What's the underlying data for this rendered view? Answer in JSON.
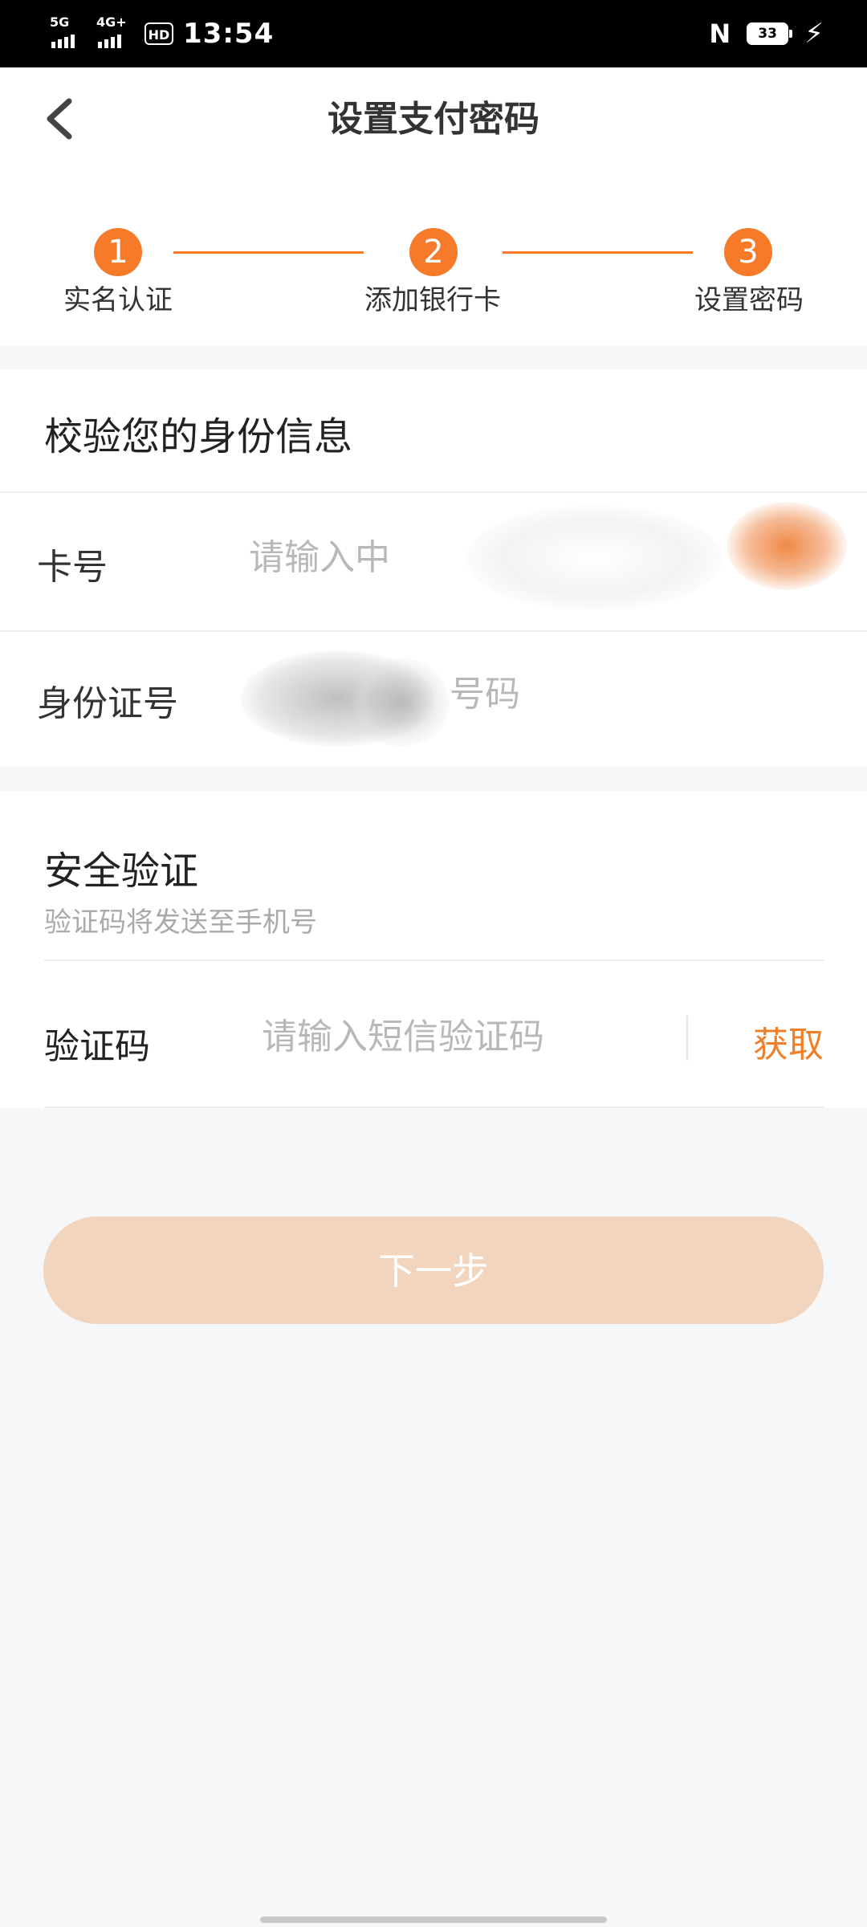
{
  "status_bar": {
    "network_1": "5G",
    "network_2": "4G+",
    "hd_badge": "HD",
    "time": "13:54",
    "nfc_icon": "N",
    "battery": "33",
    "charging_icon": "⚡"
  },
  "header": {
    "title": "设置支付密码",
    "back_icon": "chevron-left-icon"
  },
  "steps": [
    {
      "number": "1",
      "label": "实名认证"
    },
    {
      "number": "2",
      "label": "添加银行卡"
    },
    {
      "number": "3",
      "label": "设置密码"
    }
  ],
  "identity": {
    "section_title": "校验您的身份信息",
    "card_label": "卡号",
    "card_placeholder": "请输入中",
    "id_label": "身份证号",
    "id_placeholder": "号码"
  },
  "security": {
    "section_title": "安全验证",
    "hint": "验证码将发送至手机号",
    "code_label": "验证码",
    "code_placeholder": "请输入短信验证码",
    "get_code": "获取"
  },
  "next_button": "下一步",
  "colors": {
    "accent": "#f57b2a",
    "accent_text": "#f07f2a",
    "disabled_button": "#f2d5bf",
    "background": "#f6f7f9"
  }
}
